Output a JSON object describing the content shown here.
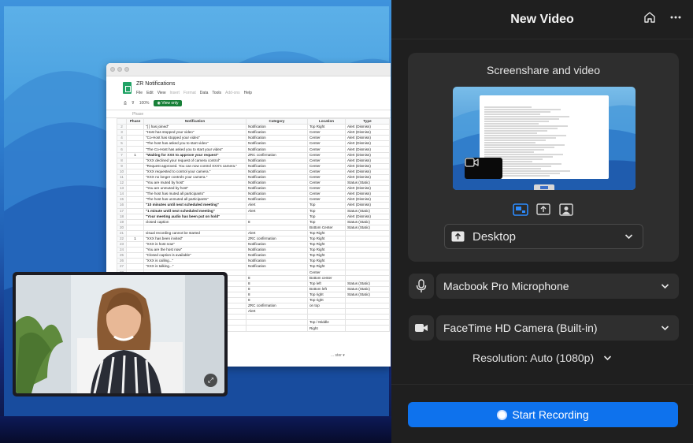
{
  "panel": {
    "title": "New Video",
    "header_icons": [
      "home-icon",
      "more-icon"
    ]
  },
  "screenshare": {
    "title": "Screenshare and video",
    "source_label": "Desktop",
    "mode_icons": [
      "screen-and-camera-icon",
      "screen-only-icon",
      "camera-only-icon"
    ],
    "active_mode": "screen-and-camera"
  },
  "microphone": {
    "label": "Macbook Pro Microphone",
    "icon": "microphone-icon"
  },
  "camera": {
    "label": "FaceTime HD Camera (Built-in)",
    "icon": "video-camera-icon"
  },
  "resolution": {
    "label": "Resolution: Auto (1080p)"
  },
  "record_button": {
    "label": "Start Recording",
    "color": "#0e72ed"
  },
  "spreadsheet": {
    "title": "ZR Notifications",
    "menu": [
      "File",
      "Edit",
      "View",
      "Insert",
      "Format",
      "Data",
      "Tools",
      "Add-ons",
      "Help"
    ],
    "zoom": "100%",
    "view_badge": "View only",
    "formula_value": "Phase",
    "columns": [
      "",
      "Phase",
      "Notification",
      "Category",
      "Location",
      "Type"
    ],
    "rows": [
      {
        "n": "2",
        "phase": "",
        "text": "\"[ ] has joined\"",
        "cat": "Notification",
        "loc": "Top Right",
        "type": "Alert (Dismiss)",
        "bold": false
      },
      {
        "n": "3",
        "phase": "",
        "text": "\"Host has stopped your video\"",
        "cat": "Notification",
        "loc": "Center",
        "type": "Alert (Dismiss)",
        "bold": false
      },
      {
        "n": "4",
        "phase": "",
        "text": "\"Co-Host has stopped your video\"",
        "cat": "Notification",
        "loc": "Center",
        "type": "Alert (Dismiss)",
        "bold": false
      },
      {
        "n": "5",
        "phase": "",
        "text": "\"The host has asked you to start video\"",
        "cat": "Notification",
        "loc": "Center",
        "type": "Alert (Dismiss)",
        "bold": false
      },
      {
        "n": "6",
        "phase": "",
        "text": "\"The Co-Host has asked you to start your video\"",
        "cat": "Notification",
        "loc": "Center",
        "type": "Alert (Dismiss)",
        "bold": false
      },
      {
        "n": "7",
        "phase": "1",
        "text": "\"Waiting for XXX to approve your request\"",
        "cat": "ZRC confirmation",
        "loc": "Center",
        "type": "Alert (Dismiss)",
        "bold": true
      },
      {
        "n": "8",
        "phase": "",
        "text": "\"XXX declined your request of camera control\"",
        "cat": "Notification",
        "loc": "Center",
        "type": "Alert (Dismiss)",
        "bold": false
      },
      {
        "n": "9",
        "phase": "",
        "text": "\"Request approved. You can now control XXX's camera.\"",
        "cat": "Notification",
        "loc": "Center",
        "type": "Alert (Dismiss)",
        "bold": false
      },
      {
        "n": "10",
        "phase": "",
        "text": "\"XXX requested to control your camera.\"",
        "cat": "Notification",
        "loc": "Center",
        "type": "Alert (Dismiss)",
        "bold": false
      },
      {
        "n": "11",
        "phase": "",
        "text": "\"XXX no longer controls your camera.\"",
        "cat": "Notification",
        "loc": "Center",
        "type": "Alert (Dismiss)",
        "bold": false
      },
      {
        "n": "12",
        "phase": "",
        "text": "\"You are muted by host\"",
        "cat": "Notification",
        "loc": "Center",
        "type": "Status (Static)",
        "bold": false
      },
      {
        "n": "13",
        "phase": "",
        "text": "\"You are unmuted by host\"",
        "cat": "Notification",
        "loc": "Center",
        "type": "Alert (Dismiss)",
        "bold": false
      },
      {
        "n": "14",
        "phase": "",
        "text": "\"The host has muted all participants\"",
        "cat": "Notification",
        "loc": "Center",
        "type": "Alert (Dismiss)",
        "bold": false
      },
      {
        "n": "15",
        "phase": "",
        "text": "\"The host has unmuted all participants\"",
        "cat": "Notification",
        "loc": "Center",
        "type": "Alert (Dismiss)",
        "bold": false
      },
      {
        "n": "16",
        "phase": "",
        "text": "\"10 minutes until next scheduled meeting\"",
        "cat": "Alert",
        "loc": "Top",
        "type": "Alert (Dismiss)",
        "bold": true
      },
      {
        "n": "17",
        "phase": "",
        "text": "\"1 minute until next scheduled meeting\"",
        "cat": "Alert",
        "loc": "Top",
        "type": "Status (Static)",
        "bold": true
      },
      {
        "n": "18",
        "phase": "",
        "text": "\"Your meeting audio has been put on hold\"",
        "cat": "",
        "loc": "Top",
        "type": "Alert (Dismiss)",
        "bold": true
      },
      {
        "n": "19",
        "phase": "",
        "text": "closed caption",
        "cat": "8",
        "loc": "Top",
        "type": "Status (Static)",
        "bold": false
      },
      {
        "n": "20",
        "phase": "",
        "text": "",
        "cat": "",
        "loc": "Bottom Center",
        "type": "Status (Static)",
        "bold": false
      },
      {
        "n": "21",
        "phase": "",
        "text": "visual recording cannot be started",
        "cat": "Alert",
        "loc": "Top Right",
        "type": "",
        "bold": false
      },
      {
        "n": "22",
        "phase": "1",
        "text": "\"XXX has been invited\"",
        "cat": "ZRC confirmation",
        "loc": "Top Right",
        "type": "",
        "bold": false
      },
      {
        "n": "23",
        "phase": "",
        "text": "\"XXX is host now\"",
        "cat": "Notification",
        "loc": "Top Right",
        "type": "",
        "bold": false
      },
      {
        "n": "24",
        "phase": "",
        "text": "\"You are the host now\"",
        "cat": "Notification",
        "loc": "Top Right",
        "type": "",
        "bold": false
      },
      {
        "n": "25",
        "phase": "",
        "text": "\"Closed caption is available\"",
        "cat": "Notification",
        "loc": "Top Right",
        "type": "",
        "bold": false
      },
      {
        "n": "26",
        "phase": "",
        "text": "\"XXX is calling...\"",
        "cat": "Notification",
        "loc": "Top Right",
        "type": "",
        "bold": false
      },
      {
        "n": "27",
        "phase": "",
        "text": "\"XXX is talking...\"",
        "cat": "Notification",
        "loc": "Top Right",
        "type": "",
        "bold": false
      },
      {
        "n": "28",
        "phase": "",
        "text": "",
        "cat": "",
        "loc": "Center",
        "type": "",
        "bold": false
      },
      {
        "n": "29",
        "phase": "",
        "text": "",
        "cat": "8",
        "loc": "Bottom center",
        "type": "",
        "bold": false
      },
      {
        "n": "30",
        "phase": "",
        "text": "",
        "cat": "8",
        "loc": "Top left",
        "type": "Status (Static)",
        "bold": false
      },
      {
        "n": "31",
        "phase": "",
        "text": "",
        "cat": "8",
        "loc": "Bottom left",
        "type": "Status (Static)",
        "bold": false
      },
      {
        "n": "32",
        "phase": "",
        "text": "",
        "cat": "8",
        "loc": "Top right",
        "type": "Status (Static)",
        "bold": false
      },
      {
        "n": "33",
        "phase": "",
        "text": "",
        "cat": "8",
        "loc": "Top right",
        "type": "",
        "bold": false
      },
      {
        "n": "34",
        "phase": "",
        "text": "",
        "cat": "ZRC confirmation",
        "loc": "on top",
        "type": "",
        "bold": false
      },
      {
        "n": "35",
        "phase": "",
        "text": "",
        "cat": "Alert",
        "loc": "",
        "type": "",
        "bold": false
      },
      {
        "n": "36",
        "phase": "",
        "text": "",
        "cat": "",
        "loc": "",
        "type": "",
        "bold": false
      },
      {
        "n": "37",
        "phase": "",
        "text": "",
        "cat": "",
        "loc": "Top / Middle",
        "type": "",
        "bold": false
      },
      {
        "n": "38",
        "phase": "",
        "text": "",
        "cat": "",
        "loc": "Right",
        "type": "",
        "bold": false
      }
    ],
    "sheet_tab": "... ster ▾"
  },
  "camera_preview": {
    "action_icon": "switch-camera-icon"
  }
}
